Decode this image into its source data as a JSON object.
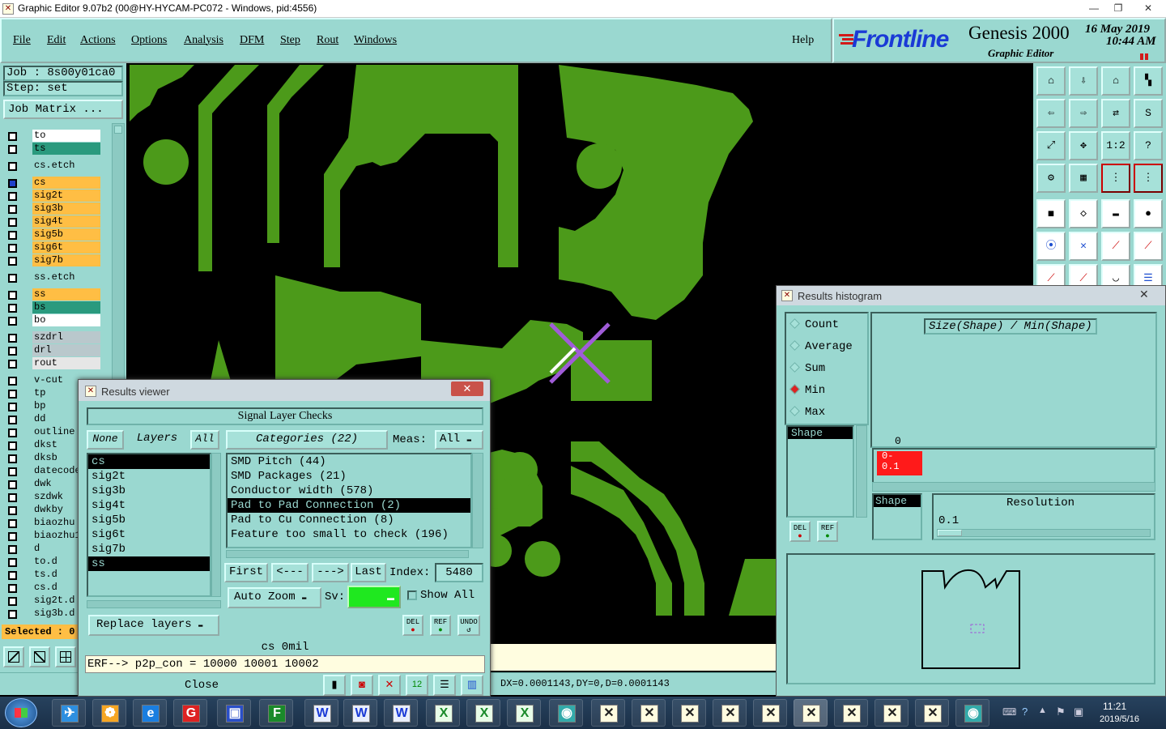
{
  "window": {
    "title": "Graphic Editor 9.07b2 (00@HY-HYCAM-PC072 - Windows, pid:4556)",
    "min": "—",
    "restore": "❐",
    "close": "✕"
  },
  "menu": [
    "File",
    "Edit",
    "Actions",
    "Options",
    "Analysis",
    "DFM",
    "Step",
    "Rout",
    "Windows"
  ],
  "help": "Help",
  "brand": {
    "logo": "Frontline",
    "product": "Genesis 2000",
    "sub": "Graphic Editor",
    "date": "16 May 2019",
    "time": "10:44 AM"
  },
  "job": {
    "job_line": "Job : 8s00y01ca0",
    "step_line": "Step: set",
    "matrix_button": "Job Matrix ..."
  },
  "layers": [
    {
      "name": "to",
      "color": "#ffffff"
    },
    {
      "name": "ts",
      "color": "#2a9a7e"
    },
    {
      "name": "cs.etch",
      "color": "#9ad8d0"
    },
    {
      "name": "cs",
      "color": "#ffbe44"
    },
    {
      "name": "sig2t",
      "color": "#ffbe44"
    },
    {
      "name": "sig3b",
      "color": "#ffbe44"
    },
    {
      "name": "sig4t",
      "color": "#ffbe44"
    },
    {
      "name": "sig5b",
      "color": "#ffbe44"
    },
    {
      "name": "sig6t",
      "color": "#ffbe44"
    },
    {
      "name": "sig7b",
      "color": "#ffbe44"
    },
    {
      "name": "ss.etch",
      "color": "#9ad8d0"
    },
    {
      "name": "ss",
      "color": "#ffbe44"
    },
    {
      "name": "bs",
      "color": "#2a9a7e"
    },
    {
      "name": "bo",
      "color": "#ffffff"
    },
    {
      "name": "szdrl",
      "color": "#b9c8cc"
    },
    {
      "name": "drl",
      "color": "#b9c8cc"
    },
    {
      "name": "rout",
      "color": "#e6e6e6"
    },
    {
      "name": "v-cut",
      "color": "#9ad8d0"
    },
    {
      "name": "tp",
      "color": "#9ad8d0"
    },
    {
      "name": "bp",
      "color": "#9ad8d0"
    },
    {
      "name": "dd",
      "color": "#9ad8d0"
    },
    {
      "name": "outline",
      "color": "#9ad8d0"
    },
    {
      "name": "dkst",
      "color": "#9ad8d0"
    },
    {
      "name": "dksb",
      "color": "#9ad8d0"
    },
    {
      "name": "datecode",
      "color": "#9ad8d0"
    },
    {
      "name": "dwk",
      "color": "#9ad8d0"
    },
    {
      "name": "szdwk",
      "color": "#9ad8d0"
    },
    {
      "name": "dwkby",
      "color": "#9ad8d0"
    },
    {
      "name": "biaozhu",
      "color": "#9ad8d0"
    },
    {
      "name": "biaozhu1",
      "color": "#9ad8d0"
    },
    {
      "name": "d",
      "color": "#9ad8d0"
    },
    {
      "name": "to.d",
      "color": "#9ad8d0"
    },
    {
      "name": "ts.d",
      "color": "#9ad8d0"
    },
    {
      "name": "cs.d",
      "color": "#9ad8d0"
    },
    {
      "name": "sig2t.d",
      "color": "#9ad8d0"
    },
    {
      "name": "sig3b.d",
      "color": "#9ad8d0"
    }
  ],
  "selected": "Selected : 0",
  "results_viewer": {
    "title": "Results viewer",
    "header": "Signal Layer Checks",
    "none": "None",
    "layers": "Layers",
    "all": "All",
    "categories_label": "Categories (22)",
    "meas_label": "Meas:",
    "meas_value": "All",
    "layer_list": [
      "cs",
      "sig2t",
      "sig3b",
      "sig4t",
      "sig5b",
      "sig6t",
      "sig7b",
      "ss"
    ],
    "categories": [
      "SMD Pitch (44)",
      "SMD Packages (21)",
      "Conductor width (578)",
      "Pad to Pad Connection (2)",
      "Pad to Cu Connection (8)",
      "Feature too small to check (196)"
    ],
    "first": "First",
    "prev": "<---",
    "next": "--->",
    "last": "Last",
    "index_label": "Index:",
    "index_value": "5480",
    "auto_zoom": "Auto Zoom",
    "sv_label": "Sv:",
    "show_all": "Show All",
    "replace_layers": "Replace layers",
    "del": "DEL",
    "ref": "REF",
    "undo": "UNDO",
    "info": "cs 0mil",
    "erf": "ERF--> p2p_con = 10000 10001 10002",
    "close": "Close"
  },
  "histogram": {
    "title": "Results histogram",
    "options": [
      "Count",
      "Average",
      "Sum",
      "Min",
      "Max"
    ],
    "selected_option": "Min",
    "formula": "Size(Shape) / Min(Shape)",
    "shape_label": "Shape",
    "zero": "0",
    "bar_label": "0-\n0.1",
    "resolution_label": "Resolution",
    "resolution_value": "0.1",
    "shape2": "Shape",
    "del": "DEL",
    "ref": "REF"
  },
  "status": {
    "coords": "DX=0.0001143,DY=0,D=0.0001143"
  },
  "taskbar": {
    "time": "11:21",
    "date": "2019/5/16"
  },
  "colors": {
    "panel": "#9ad8d0",
    "copper": "#4c9a1a",
    "marker": "#a05cd8",
    "highlight": "#ffbe44"
  }
}
